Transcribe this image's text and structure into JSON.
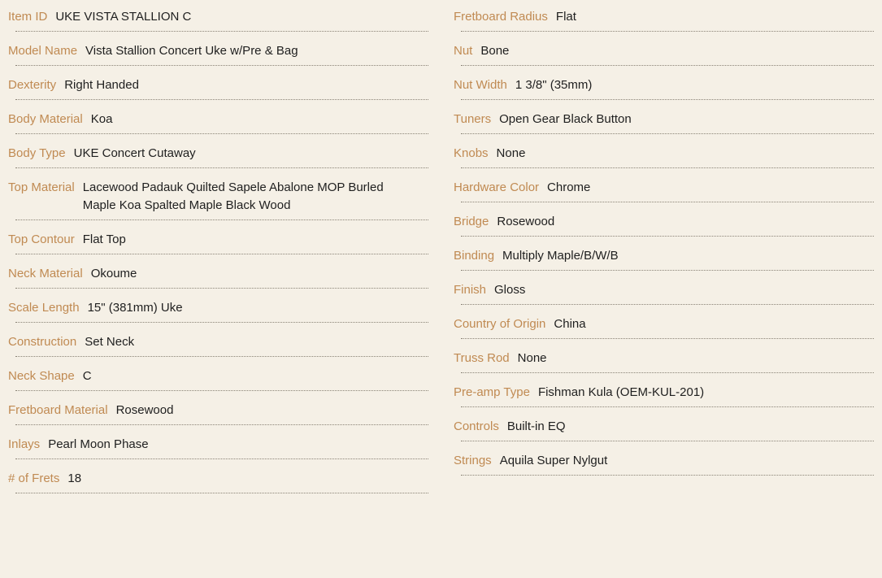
{
  "specs": {
    "left": [
      {
        "label": "Item ID",
        "value": "UKE VISTA STALLION C"
      },
      {
        "label": "Model Name",
        "value": "Vista Stallion Concert Uke w/Pre & Bag"
      },
      {
        "label": "Dexterity",
        "value": "Right Handed"
      },
      {
        "label": "Body Material",
        "value": "Koa"
      },
      {
        "label": "Body Type",
        "value": "UKE Concert Cutaway"
      },
      {
        "label": "Top Material",
        "value": "Lacewood Padauk Quilted Sapele Abalone MOP Burled Maple Koa Spalted Maple Black Wood"
      },
      {
        "label": "Top Contour",
        "value": "Flat Top"
      },
      {
        "label": "Neck Material",
        "value": "Okoume"
      },
      {
        "label": "Scale Length",
        "value": "15\" (381mm) Uke"
      },
      {
        "label": "Construction",
        "value": "Set Neck"
      },
      {
        "label": "Neck Shape",
        "value": "C"
      },
      {
        "label": "Fretboard Material",
        "value": "Rosewood"
      },
      {
        "label": "Inlays",
        "value": "Pearl Moon Phase"
      },
      {
        "label": "# of Frets",
        "value": "18"
      }
    ],
    "right": [
      {
        "label": "Fretboard Radius",
        "value": "Flat"
      },
      {
        "label": "Nut",
        "value": "Bone"
      },
      {
        "label": "Nut Width",
        "value": "1 3/8\" (35mm)"
      },
      {
        "label": "Tuners",
        "value": "Open Gear Black Button"
      },
      {
        "label": "Knobs",
        "value": "None"
      },
      {
        "label": "Hardware Color",
        "value": "Chrome"
      },
      {
        "label": "Bridge",
        "value": "Rosewood"
      },
      {
        "label": "Binding",
        "value": "Multiply Maple/B/W/B"
      },
      {
        "label": "Finish",
        "value": "Gloss"
      },
      {
        "label": "Country of Origin",
        "value": "China"
      },
      {
        "label": "Truss Rod",
        "value": "None"
      },
      {
        "label": "Pre-amp Type",
        "value": "Fishman Kula (OEM-KUL-201)"
      },
      {
        "label": "Controls",
        "value": "Built-in EQ"
      },
      {
        "label": "Strings",
        "value": "Aquila Super Nylgut"
      }
    ]
  }
}
